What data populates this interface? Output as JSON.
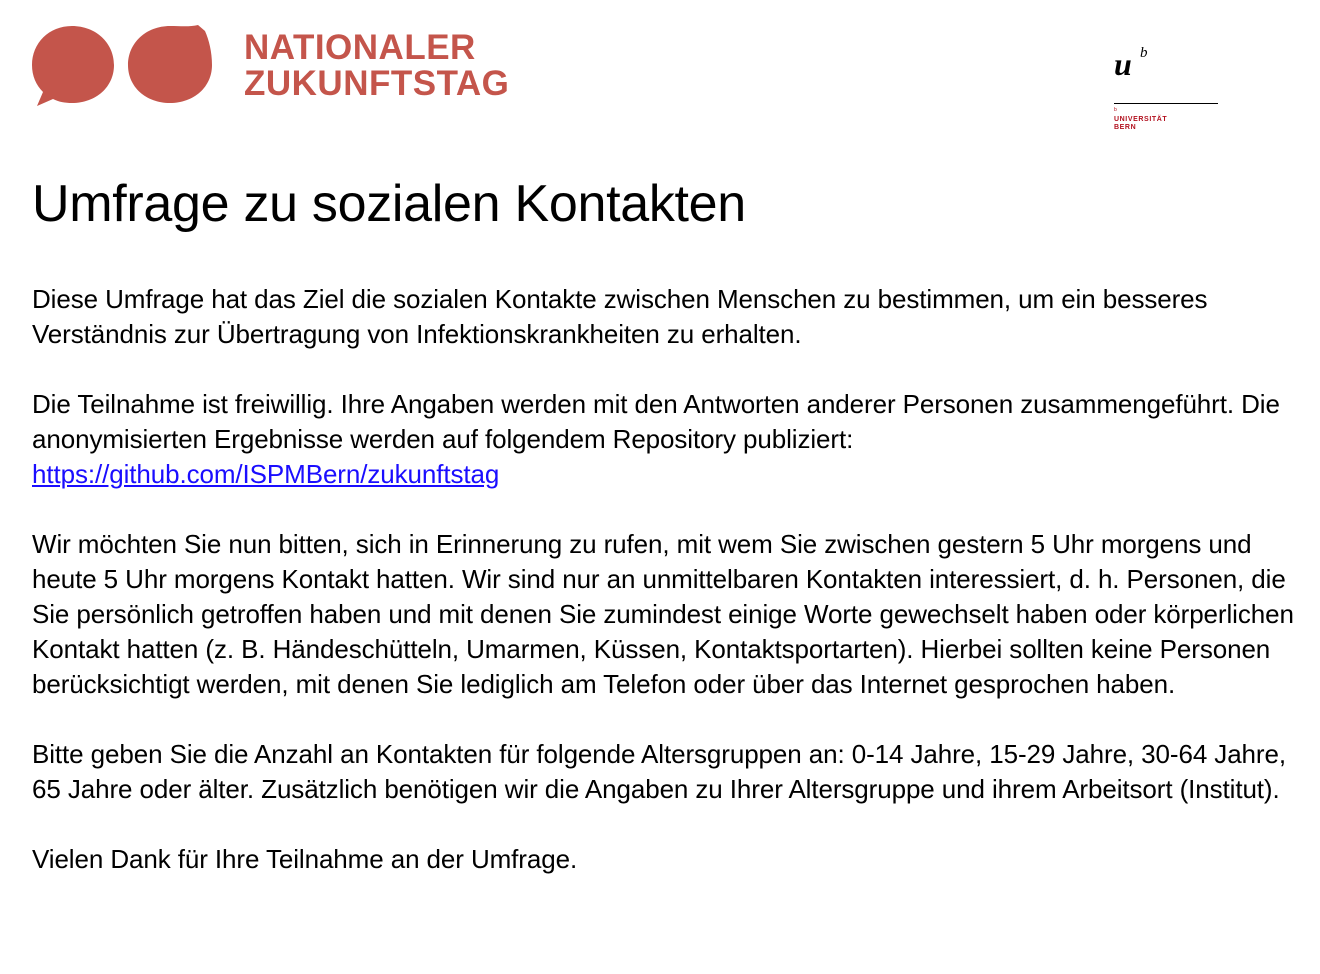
{
  "header": {
    "event_logo": {
      "line1": "NATIONALER",
      "line2": "ZUKUNFTSTAG",
      "color": "#c4554b"
    },
    "university_logo": {
      "mark": "u",
      "superscript": "b",
      "small_mark": "b",
      "line1": "UNIVERSITÄT",
      "line2": "BERN",
      "color": "#b2101e"
    }
  },
  "document": {
    "title": "Umfrage zu sozialen Kontakten",
    "paragraph1": "Diese Umfrage hat das Ziel die sozialen Kontakte zwischen Menschen zu bestimmen, um ein besseres Verständnis zur Übertragung von Infektionskrankheiten zu erhalten.",
    "paragraph2_text": "Die Teilnahme ist freiwillig. Ihre Angaben werden mit den Antworten anderer Personen zusammengeführt. Die anonymisierten Ergebnisse werden auf folgendem Repository publiziert: ",
    "repository_link": "https://github.com/ISPMBern/zukunftstag",
    "link_color": "#1a0dff",
    "paragraph3": "Wir möchten Sie nun bitten, sich in Erinnerung zu rufen, mit wem Sie zwischen gestern 5 Uhr morgens und heute 5 Uhr morgens Kontakt hatten. Wir sind nur an unmittelbaren Kontakten interessiert, d. h. Personen, die Sie persönlich getroffen haben und mit denen Sie zumindest einige Worte gewechselt haben oder körperlichen Kontakt hatten (z. B. Händeschütteln, Umarmen, Küssen, Kontaktsportarten). Hierbei sollten keine Personen berücksichtigt werden, mit denen Sie lediglich am Telefon oder über das Internet gesprochen haben.",
    "paragraph4": "Bitte geben Sie die Anzahl an Kontakten für folgende Altersgruppen an: 0-14 Jahre, 15-29 Jahre, 30-64 Jahre, 65 Jahre oder älter. Zusätzlich benötigen wir die Angaben zu Ihrer Altersgruppe und ihrem Arbeitsort (Institut).",
    "paragraph5": "Vielen Dank für Ihre Teilnahme an der Umfrage."
  }
}
